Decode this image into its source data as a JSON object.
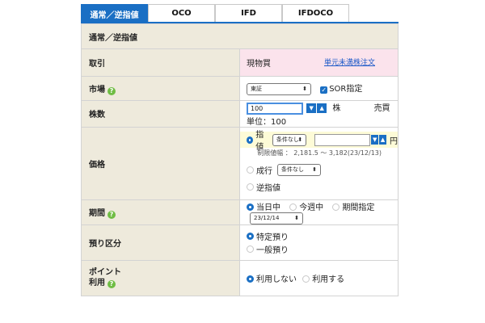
{
  "tabs": [
    "通常／逆指値",
    "OCO",
    "IFD",
    "IFDOCO"
  ],
  "section_title": "通常／逆指値",
  "rows": {
    "trade": {
      "label": "取引",
      "value": "現物買",
      "link": "単元未満株注文"
    },
    "market": {
      "label": "市場",
      "select": "東証",
      "checkbox_label": "SOR指定"
    },
    "shares": {
      "label": "株数",
      "value": "100",
      "unit": "株",
      "trade_unit": "売買単位：100"
    },
    "price": {
      "label": "価格",
      "limit_label": "指値",
      "condition": "条件なし",
      "yen": "円",
      "range": "制限値幅 ： 2,181.5 〜 3,182(23/12/13)",
      "market_label": "成行",
      "stop_label": "逆指値"
    },
    "period": {
      "label": "期間",
      "today": "当日中",
      "week": "今週中",
      "specify": "期間指定",
      "date": "23/12/14"
    },
    "deposit": {
      "label": "預り区分",
      "specific": "特定預り",
      "general": "一般預り"
    },
    "points": {
      "label1": "ポイント",
      "label2": "利用",
      "no": "利用しない",
      "yes": "利用する"
    }
  },
  "icons": {
    "help": "?",
    "check": "✓",
    "down": "▼",
    "up": "▲",
    "updown": "⬍"
  },
  "colors": {
    "accent": "#1a6fc4",
    "label_bg": "#eeeadc",
    "pink": "#fbe3ec",
    "help": "#6fbd44"
  }
}
